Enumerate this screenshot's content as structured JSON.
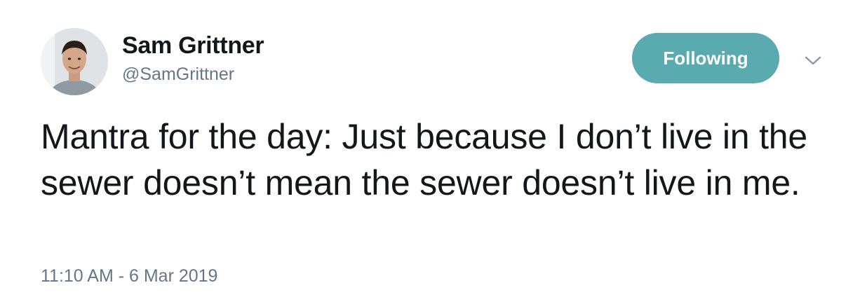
{
  "author": {
    "display_name": "Sam Grittner",
    "handle": "@SamGrittner",
    "avatar_icon": "user-avatar"
  },
  "actions": {
    "follow_label": "Following",
    "follow_color": "#5aabaf",
    "menu_icon": "chevron-down-icon"
  },
  "tweet": {
    "text": "Mantra for the day: Just because I don’t live in the sewer doesn’t mean the sewer doesn’t live in me.",
    "timestamp": "11:10 AM - 6 Mar 2019"
  },
  "colors": {
    "text_primary": "#14171a",
    "text_secondary": "#657786",
    "background": "#ffffff"
  }
}
